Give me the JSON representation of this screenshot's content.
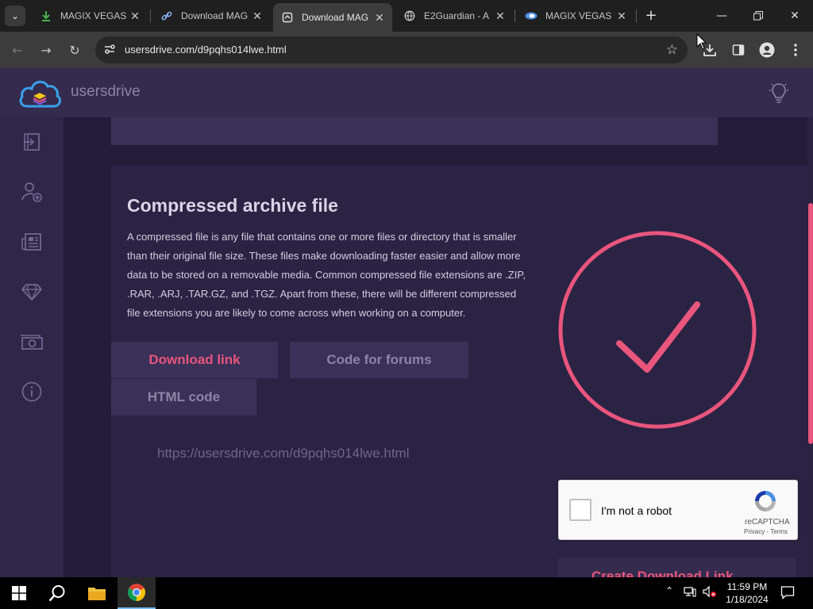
{
  "browser": {
    "tabs": [
      {
        "label": "MAGIX VEGAS",
        "icon": "download-arrow-icon",
        "active": false
      },
      {
        "label": "Download MAG",
        "icon": "link-icon",
        "active": false
      },
      {
        "label": "Download MAG",
        "icon": "page-icon",
        "active": true
      },
      {
        "label": "E2Guardian - A",
        "icon": "globe-icon",
        "active": false
      },
      {
        "label": "MAGIX VEGAS",
        "icon": "vegas-icon",
        "active": false
      }
    ],
    "url": "usersdrive.com/d9pqhs014lwe.html"
  },
  "site": {
    "brand": "usersdrive"
  },
  "content": {
    "title": "Compressed archive file",
    "description": "A compressed file is any file that contains one or more files or directory that is smaller than their original file size. These files make downloading faster easier and allow more data to be stored on a removable media. Common compressed file extensions are .ZIP, .RAR, .ARJ, .TAR.GZ, and .TGZ. Apart from these, there will be different compressed file extensions you are likely to come across when working on a computer.",
    "tabs": {
      "download_link": "Download link",
      "code_for_forums": "Code for forums",
      "html_code": "HTML code"
    },
    "link_value": "https://usersdrive.com/d9pqhs014lwe.html",
    "create_button": "Create Download Link"
  },
  "recaptcha": {
    "label": "I'm not a robot",
    "brand": "reCAPTCHA",
    "terms": "Privacy - Terms"
  },
  "taskbar": {
    "time": "11:59 PM",
    "date": "1/18/2024"
  },
  "colors": {
    "accent": "#e8557d",
    "page_bg": "#2a2241",
    "card_bg": "#2b2343"
  }
}
